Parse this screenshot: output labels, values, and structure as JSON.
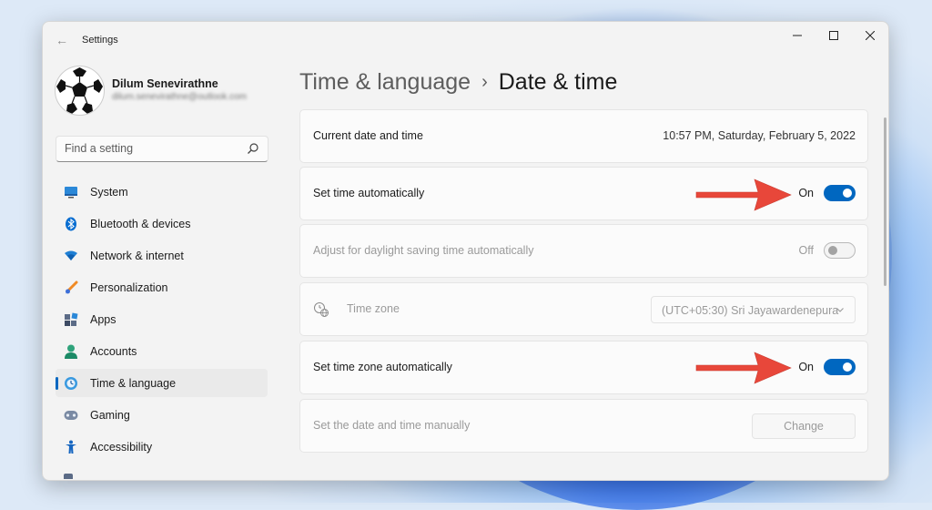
{
  "window": {
    "title": "Settings"
  },
  "profile": {
    "name": "Dilum Senevirathne",
    "email": "dilum.senevirathne@outlook.com"
  },
  "search": {
    "placeholder": "Find a setting"
  },
  "nav": {
    "items": [
      {
        "label": "System",
        "icon": "monitor-icon"
      },
      {
        "label": "Bluetooth & devices",
        "icon": "bluetooth-icon"
      },
      {
        "label": "Network & internet",
        "icon": "wifi-icon"
      },
      {
        "label": "Personalization",
        "icon": "brush-icon"
      },
      {
        "label": "Apps",
        "icon": "apps-icon"
      },
      {
        "label": "Accounts",
        "icon": "person-icon"
      },
      {
        "label": "Time & language",
        "icon": "globe-clock-icon",
        "active": true
      },
      {
        "label": "Gaming",
        "icon": "gamepad-icon"
      },
      {
        "label": "Accessibility",
        "icon": "accessibility-icon"
      }
    ]
  },
  "breadcrumb": {
    "parent": "Time & language",
    "separator": "›",
    "current": "Date & time"
  },
  "settings": {
    "current": {
      "label": "Current date and time",
      "value": "10:57 PM, Saturday, February 5, 2022"
    },
    "set_time_auto": {
      "label": "Set time automatically",
      "state": "On"
    },
    "daylight": {
      "label": "Adjust for daylight saving time automatically",
      "state": "Off"
    },
    "timezone": {
      "label": "Time zone",
      "value": "(UTC+05:30) Sri Jayawardenepura"
    },
    "set_tz_auto": {
      "label": "Set time zone automatically",
      "state": "On"
    },
    "manual": {
      "label": "Set the date and time manually",
      "button": "Change"
    }
  },
  "colors": {
    "accent": "#0067c0",
    "annotation_arrow": "#e8473a"
  }
}
